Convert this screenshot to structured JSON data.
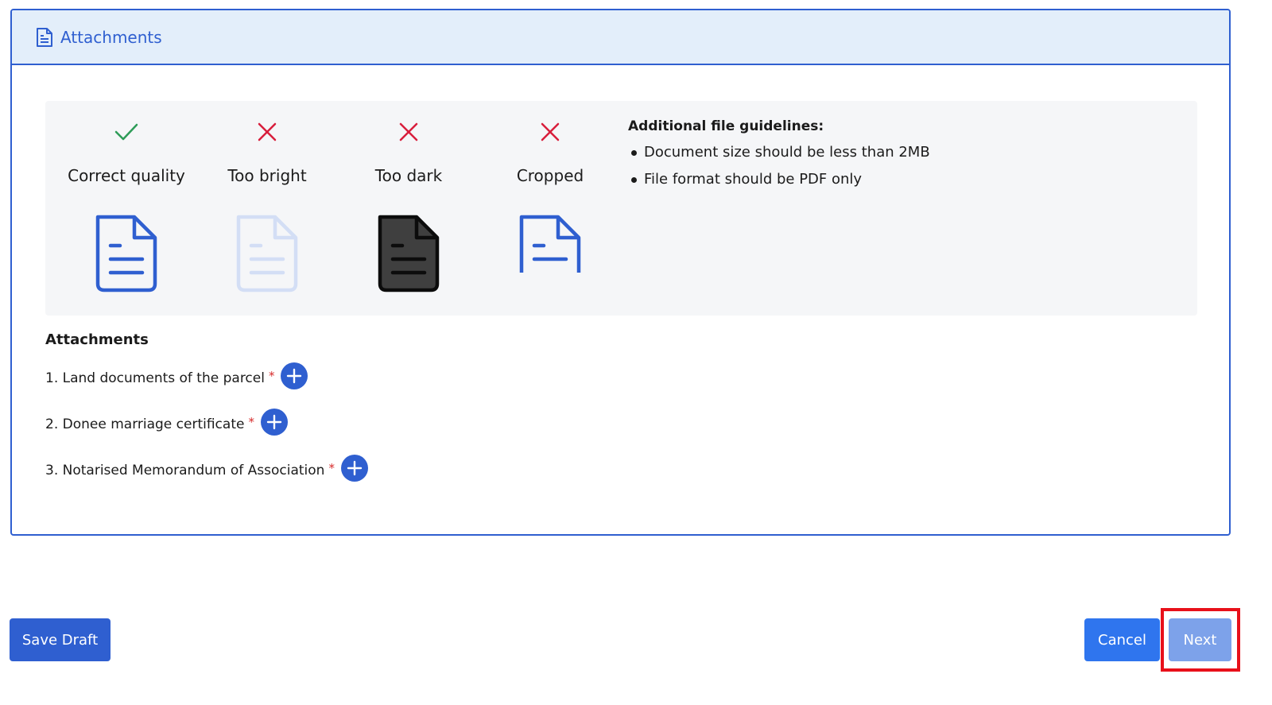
{
  "header": {
    "icon": "document-icon",
    "title": "Attachments"
  },
  "examples": [
    {
      "label": "Correct quality",
      "status": "check-icon",
      "status_color": "#2e9c58",
      "style": "correct"
    },
    {
      "label": "Too bright",
      "status": "cross-icon",
      "status_color": "#d81e3c",
      "style": "bright"
    },
    {
      "label": "Too dark",
      "status": "cross-icon",
      "status_color": "#d81e3c",
      "style": "dark"
    },
    {
      "label": "Cropped",
      "status": "cross-icon",
      "status_color": "#d81e3c",
      "style": "cropped"
    }
  ],
  "guidelines": {
    "title": "Additional file guidelines:",
    "items": [
      "Document size should be less than 2MB",
      "File format should be PDF only"
    ]
  },
  "attachments": {
    "title": "Attachments",
    "items": [
      {
        "label": "1. Land documents of the parcel",
        "required_mark": "*"
      },
      {
        "label": "2. Donee marriage certificate",
        "required_mark": "*"
      },
      {
        "label": "3. Notarised Memorandum of Association",
        "required_mark": "*"
      }
    ]
  },
  "footer": {
    "save_draft_label": "Save Draft",
    "cancel_label": "Cancel",
    "next_label": "Next"
  },
  "colors": {
    "primary": "#2f5fd0",
    "header_bg": "#e3eefa",
    "required": "#d62b2b",
    "highlight": "#e8101a"
  }
}
